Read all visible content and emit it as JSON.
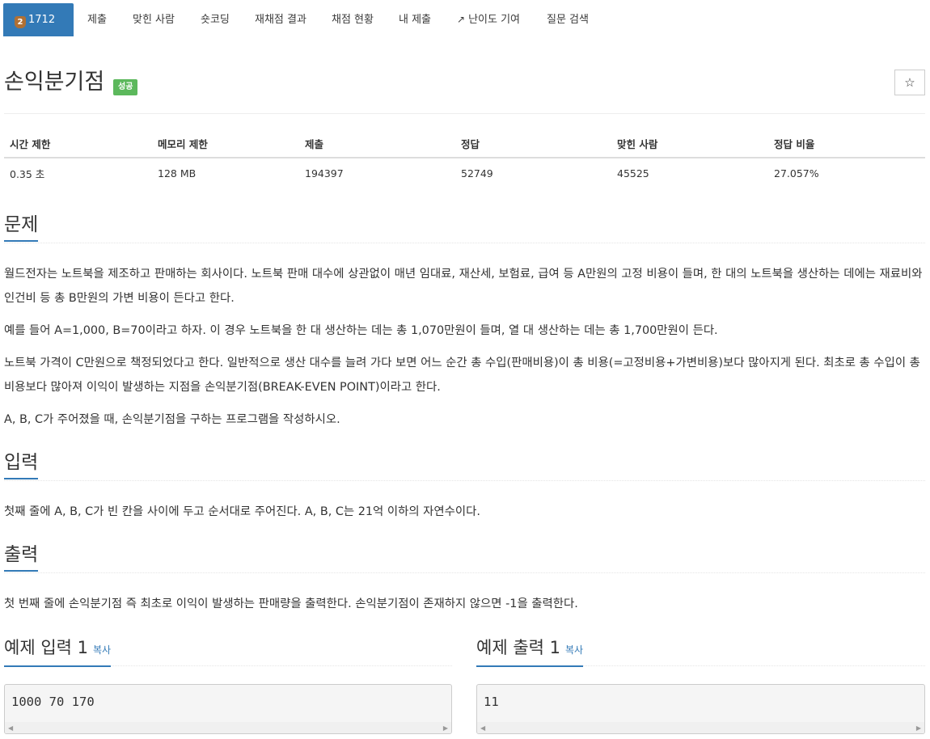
{
  "nav": {
    "problem_badge": "2",
    "tabs": [
      {
        "label": "1712번",
        "active": true
      },
      {
        "label": "제출"
      },
      {
        "label": "맞힌 사람"
      },
      {
        "label": "숏코딩"
      },
      {
        "label": "재채점 결과"
      },
      {
        "label": "채점 현황"
      },
      {
        "label": "내 제출"
      },
      {
        "label": "난이도 기여",
        "icon": "external-link-icon"
      },
      {
        "label": "질문 검색"
      }
    ]
  },
  "header": {
    "title": "손익분기점",
    "status": "성공",
    "star": "☆"
  },
  "stats": {
    "headers": [
      "시간 제한",
      "메모리 제한",
      "제출",
      "정답",
      "맞힌 사람",
      "정답 비율"
    ],
    "values": [
      "0.35 초",
      "128 MB",
      "194397",
      "52749",
      "45525",
      "27.057%"
    ]
  },
  "problem": {
    "heading": "문제",
    "paragraphs": [
      "월드전자는 노트북을 제조하고 판매하는 회사이다. 노트북 판매 대수에 상관없이 매년 임대료, 재산세, 보험료, 급여 등 A만원의 고정 비용이 들며, 한 대의 노트북을 생산하는 데에는 재료비와 인건비 등 총 B만원의 가변 비용이 든다고 한다.",
      "예를 들어 A=1,000, B=70이라고 하자. 이 경우 노트북을 한 대 생산하는 데는 총 1,070만원이 들며, 열 대 생산하는 데는 총 1,700만원이 든다.",
      "노트북 가격이 C만원으로 책정되었다고 한다. 일반적으로 생산 대수를 늘려 가다 보면 어느 순간 총 수입(판매비용)이 총 비용(=고정비용+가변비용)보다 많아지게 된다. 최초로 총 수입이 총 비용보다 많아져 이익이 발생하는 지점을 손익분기점(BREAK-EVEN POINT)이라고 한다.",
      "A, B, C가 주어졌을 때, 손익분기점을 구하는 프로그램을 작성하시오."
    ]
  },
  "input": {
    "heading": "입력",
    "text": "첫째 줄에 A, B, C가 빈 칸을 사이에 두고 순서대로 주어진다. A, B, C는 21억 이하의 자연수이다."
  },
  "output": {
    "heading": "출력",
    "text": "첫 번째 줄에 손익분기점 즉 최초로 이익이 발생하는 판매량을 출력한다. 손익분기점이 존재하지 않으면 -1을 출력한다."
  },
  "samples": {
    "input_heading": "예제 입력 1",
    "output_heading": "예제 출력 1",
    "copy_label": "복사",
    "input_value": "1000 70 170",
    "output_value": "11"
  }
}
